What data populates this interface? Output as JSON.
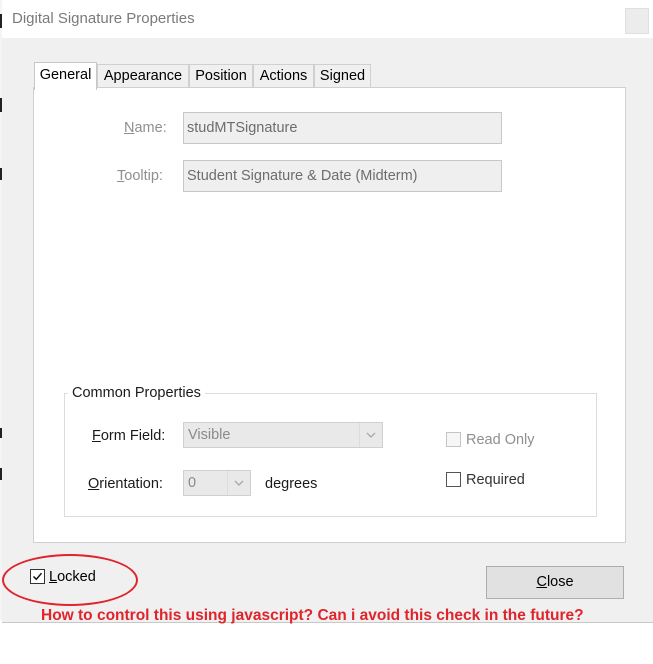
{
  "window": {
    "title": "Digital Signature Properties"
  },
  "tabs": [
    {
      "label": "General",
      "active": true
    },
    {
      "label": "Appearance",
      "active": false
    },
    {
      "label": "Position",
      "active": false
    },
    {
      "label": "Actions",
      "active": false
    },
    {
      "label": "Signed",
      "active": false
    }
  ],
  "general": {
    "name_label_prefix": "",
    "name_label_mnemonic": "N",
    "name_label_rest": "ame:",
    "name_value": "studMTSignature",
    "tooltip_label_mnemonic": "T",
    "tooltip_label_rest": "ooltip:",
    "tooltip_value": "Student Signature & Date (Midterm)"
  },
  "common_properties": {
    "title": "Common Properties",
    "form_field_label_mnemonic": "F",
    "form_field_label_rest": "orm Field:",
    "form_field_value": "Visible",
    "orientation_label_mnemonic": "O",
    "orientation_label_rest": "rientation:",
    "orientation_value": "0",
    "orientation_unit": "degrees",
    "read_only_label": "Read Only",
    "read_only_checked": false,
    "required_label": "Required",
    "required_checked": false
  },
  "footer": {
    "locked_mnemonic": "L",
    "locked_rest": "ocked",
    "locked_checked": true,
    "close_mnemonic": "C",
    "close_rest": "lose"
  },
  "annotation": {
    "text": "How to control this using javascript? Can i avoid this check in the future?",
    "color": "#e0242c"
  },
  "colors": {
    "dialog_bg": "#f0f0f0",
    "panel_bg": "#ffffff",
    "disabled_text": "#8f8f8f"
  }
}
